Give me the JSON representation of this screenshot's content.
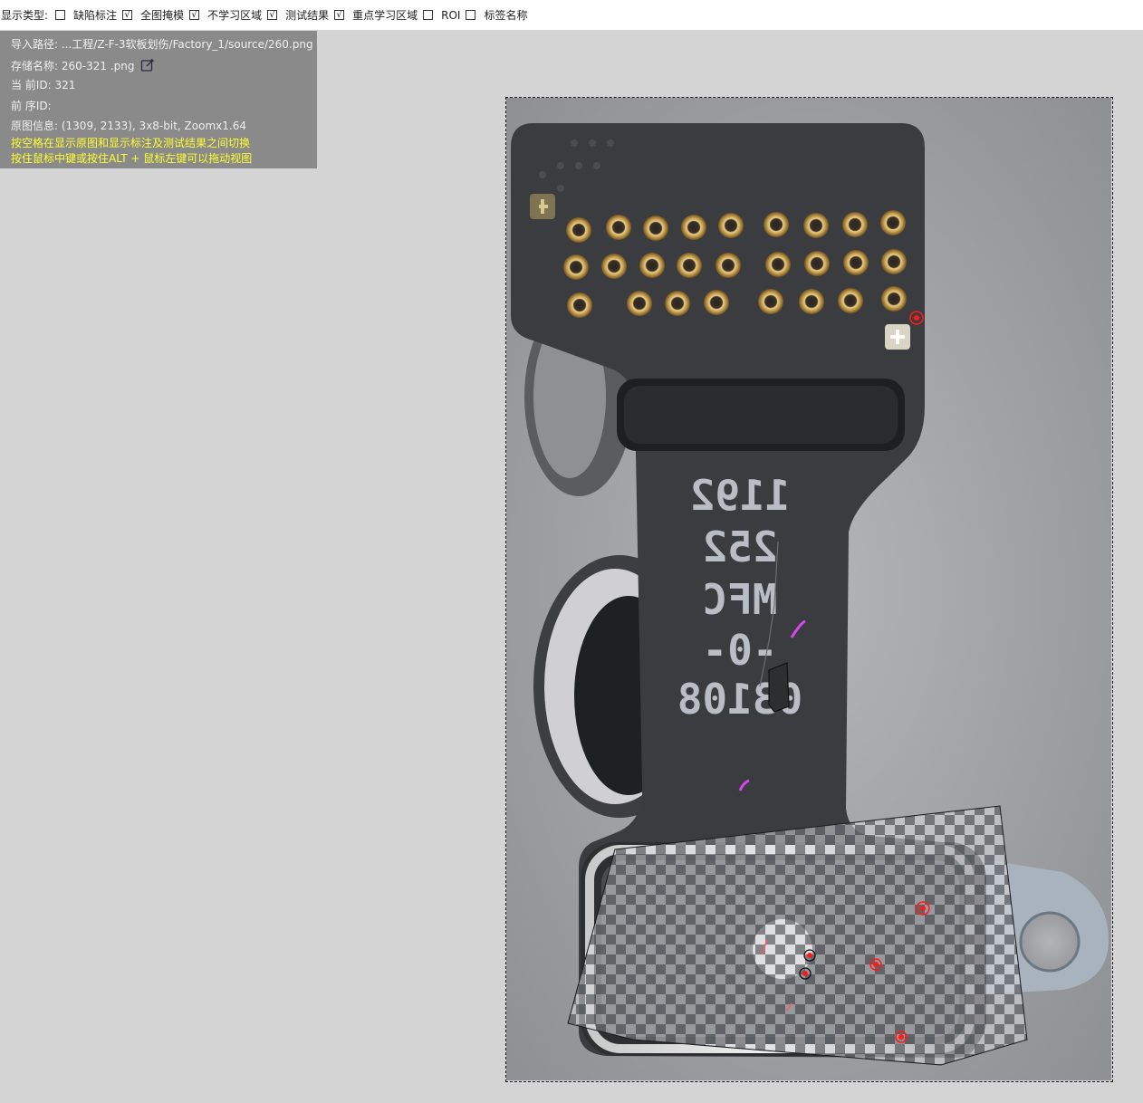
{
  "toolbar": {
    "label": "显示类型:",
    "options": [
      {
        "label": "缺陷标注",
        "checked": false,
        "mark": ""
      },
      {
        "label": "全图掩模",
        "checked": true,
        "mark": "√"
      },
      {
        "label": "不学习区域",
        "checked": true,
        "mark": "√"
      },
      {
        "label": "测试结果",
        "checked": true,
        "mark": "√"
      },
      {
        "label": "重点学习区域",
        "checked": true,
        "mark": "√"
      },
      {
        "label": "ROI",
        "checked": false,
        "mark": ""
      },
      {
        "label": "标签名称",
        "checked": false,
        "mark": ""
      }
    ]
  },
  "info": {
    "import_path": "导入路径: ...工程/Z-F-3软板划伤/Factory_1/source/260.png",
    "save_name": "存储名称: 260-321  .png",
    "current_id": "当 前ID: 321",
    "prev_id": "前 序ID:",
    "orig_info": "原图信息: (1309, 2133), 3x8-bit, Zoomx1.64",
    "hint1": "按空格在显示原图和显示标注及测试结果之间切换",
    "hint2": "按住鼠标中键或按住ALT + 鼠标左键可以拖动视图"
  },
  "image": {
    "printed_text_lines": [
      "1192",
      "252",
      "MFC",
      "-0-",
      "03108"
    ],
    "colors": {
      "background_plate": "#a7a9ac",
      "flex_board": "#3a3b3d",
      "gold_pad": "#c8a45a",
      "defect_mark": "#ff1a1a",
      "scratch_mark": "#d946ef"
    }
  }
}
